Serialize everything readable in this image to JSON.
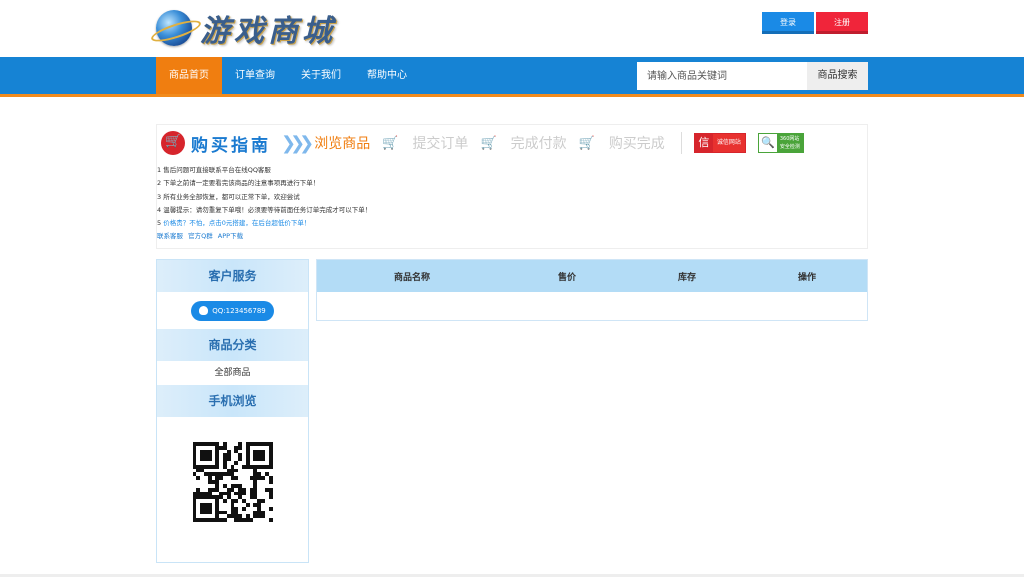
{
  "header": {
    "logo_text": "游戏商城",
    "login_label": "登录",
    "register_label": "注册"
  },
  "nav": {
    "items": [
      {
        "label": "商品首页",
        "active": true
      },
      {
        "label": "订单查询"
      },
      {
        "label": "关于我们"
      },
      {
        "label": "帮助中心"
      }
    ],
    "search_placeholder": "请输入商品关键词",
    "search_button": "商品搜索"
  },
  "guide": {
    "title": "购买指南",
    "steps": [
      "浏览商品",
      "提交订单",
      "完成付款",
      "购买完成"
    ],
    "badge_xin": {
      "icon": "信",
      "label": "诚信网站"
    },
    "badge_360": {
      "line1": "360网站",
      "line2": "安全检测"
    },
    "notes": [
      "1 售后问题可直接联系平台在线QQ客服",
      "2 下单之前请一定要看完该商品的注意事项再进行下单！",
      "3 所有业务全部恢复，都可以正常下单，欢迎尝试",
      "4 温馨提示：请勿重复下单哦！必须要等待前面任务订单完成才可以下单！"
    ],
    "note5_prefix": "5 ",
    "note5_text": "价格贵？不怕，点击0元搭建，在后台超低价下单！",
    "links": [
      "联系客服",
      "官方Q群",
      "APP下载"
    ]
  },
  "sidebar": {
    "service_title": "客户服务",
    "qq_label": "QQ:123456789",
    "category_title": "商品分类",
    "category_item": "全部商品",
    "mobile_title": "手机浏览"
  },
  "table": {
    "headers": [
      "商品名称",
      "售价",
      "库存",
      "操作"
    ]
  },
  "colors": {
    "nav_blue": "#1683d4",
    "nav_active": "#f07e10",
    "login": "#1a8ae6",
    "register": "#f0253a",
    "table_head": "#b3dcf6"
  }
}
